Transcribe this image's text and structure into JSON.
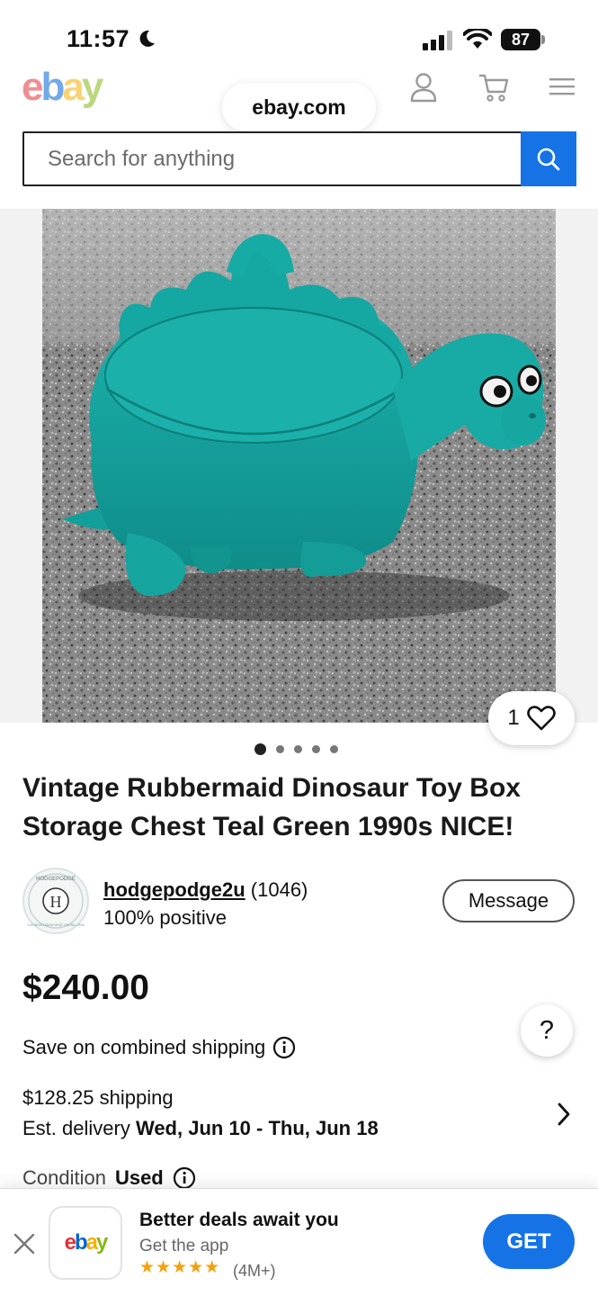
{
  "status_bar": {
    "time": "11:57",
    "battery": "87"
  },
  "header": {
    "logo_letters": [
      "e",
      "b",
      "a",
      "y"
    ],
    "url": "ebay.com",
    "search_placeholder": "Search for anything",
    "icons": [
      "account-icon",
      "cart-icon",
      "menu-icon",
      "search-icon"
    ]
  },
  "gallery": {
    "image_count": 5,
    "active_index": 0,
    "like_count": "1"
  },
  "listing": {
    "title": "Vintage Rubbermaid Dinosaur Toy Box Storage Chest Teal Green 1990s NICE!",
    "seller": {
      "username": "hodgepodge2u",
      "feedback_count": "(1046)",
      "positive": "100% positive",
      "message_label": "Message",
      "avatar_text_top": "HODGEPODGE",
      "avatar_letter": "H",
      "avatar_text_ring": "YOU NEVER KNOW WHAT YOU WILL FIND"
    },
    "price": "$240.00",
    "combined_shipping": "Save on combined shipping",
    "shipping": "$128.25 shipping",
    "delivery_prefix": "Est. delivery",
    "delivery_dates": "Wed, Jun 10 - Thu, Jun 18",
    "condition_label": "Condition",
    "condition_value": "Used",
    "help": "?"
  },
  "app_banner": {
    "logo_letters": [
      "e",
      "b",
      "a",
      "y"
    ],
    "title": "Better deals await you",
    "subtitle": "Get the app",
    "stars": "★★★★★",
    "rating_count": "(4M+)",
    "button": "GET"
  },
  "colors": {
    "accent_blue": "#1573e6",
    "dino_teal": "#16a39e"
  }
}
